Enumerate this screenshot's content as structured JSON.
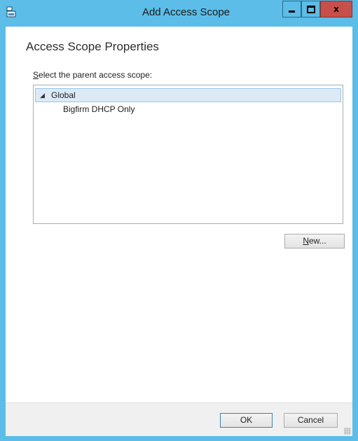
{
  "window": {
    "title": "Add Access Scope",
    "close_glyph": "x",
    "icon": "app-window-icon"
  },
  "dialog": {
    "header": "Access Scope Properties",
    "select_label_mnemonic": "S",
    "select_label_rest": "elect the parent access scope:"
  },
  "tree": {
    "expander_glyph": "◢",
    "root": {
      "label": "Global",
      "expanded": true,
      "selected": true
    },
    "children": [
      {
        "label": "Bigfirm DHCP Only"
      }
    ]
  },
  "buttons": {
    "new_mnemonic": "N",
    "new_rest": "ew...",
    "ok": "OK",
    "cancel": "Cancel"
  },
  "colors": {
    "titlebar": "#5bbde8",
    "close_button": "#c7504a",
    "selection": "#dceaf7"
  }
}
